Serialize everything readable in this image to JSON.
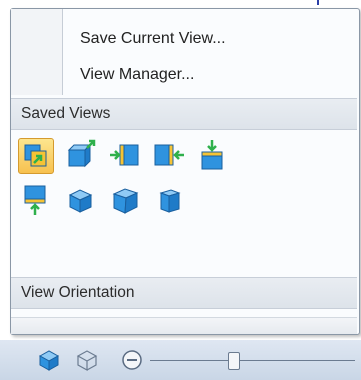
{
  "menu": {
    "items": [
      {
        "label": "Save Current View..."
      },
      {
        "label": "View Manager..."
      }
    ],
    "sections": {
      "saved_views": "Saved Views",
      "view_orientation": "View Orientation"
    }
  },
  "orientation_buttons": [
    {
      "icon": "normal-to-icon",
      "selected": true
    },
    {
      "icon": "isometric-back-icon",
      "selected": false
    },
    {
      "icon": "front-view-icon",
      "selected": false
    },
    {
      "icon": "back-view-icon",
      "selected": false
    },
    {
      "icon": "top-view-icon",
      "selected": false
    },
    {
      "icon": "bottom-view-icon",
      "selected": false
    },
    {
      "icon": "isometric-view-icon",
      "selected": false
    },
    {
      "icon": "trimetric-view-icon",
      "selected": false
    },
    {
      "icon": "dimetric-view-icon",
      "selected": false
    }
  ],
  "status_bar": {
    "icons": [
      "shaded-view-icon",
      "wireframe-view-icon",
      "zoom-out-icon"
    ]
  },
  "colors": {
    "cube_blue": "#2f93df",
    "arrow_green": "#2fb04c",
    "face_yellow": "#f6c334",
    "selected_bg": "#f7c14f"
  }
}
